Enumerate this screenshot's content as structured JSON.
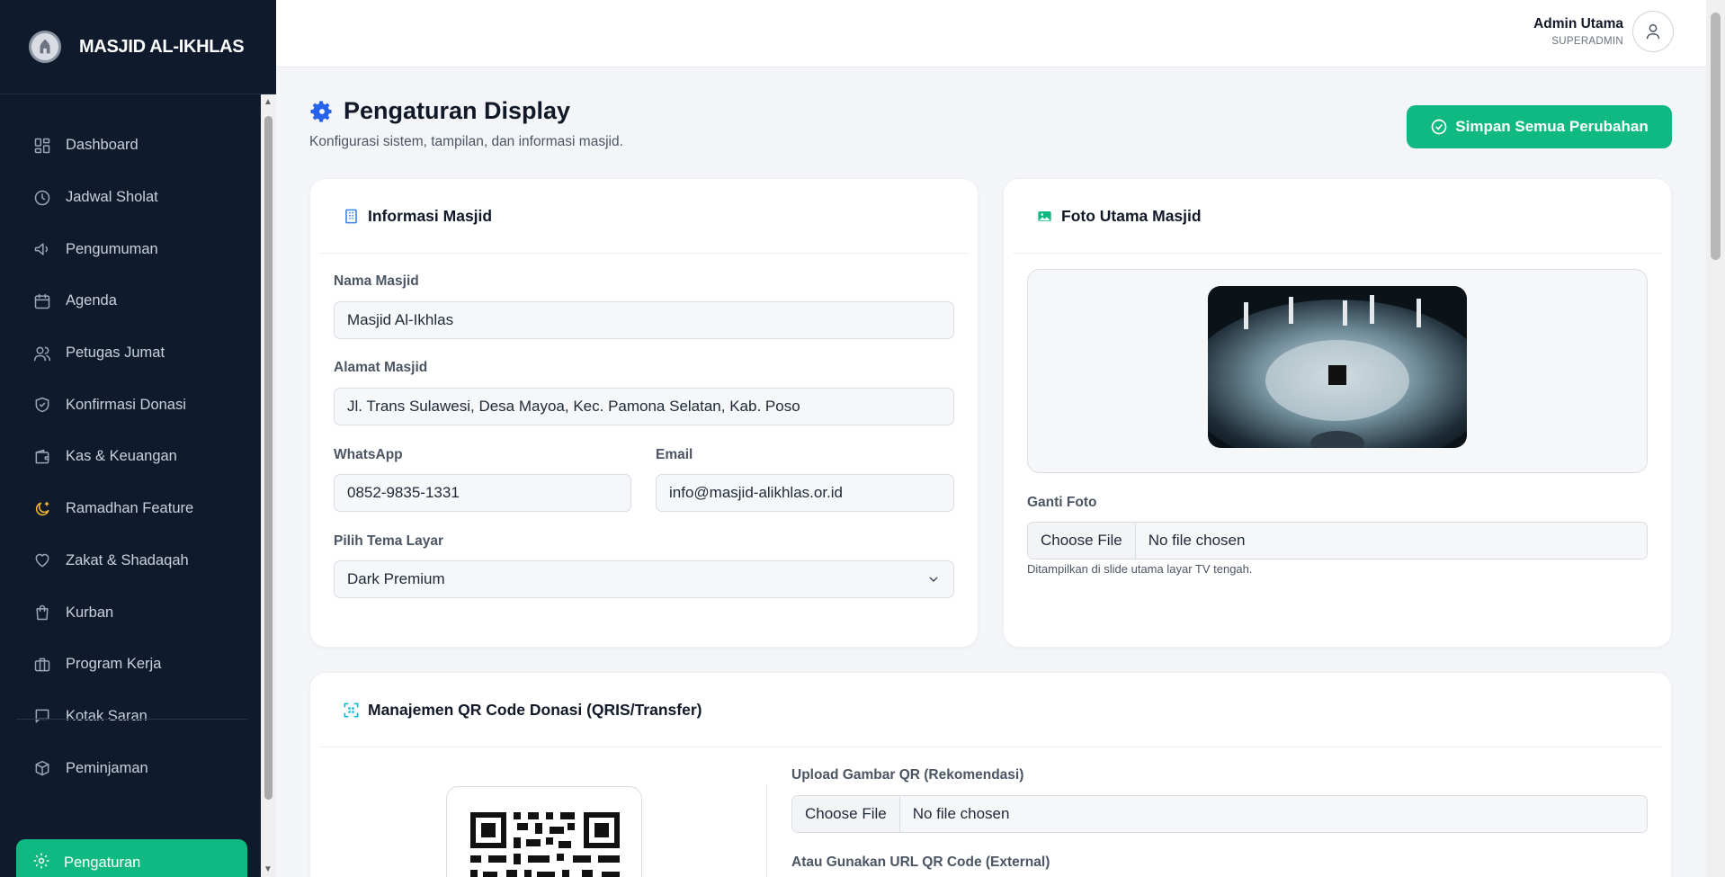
{
  "brand": {
    "title": "MASJID AL-IKHLAS"
  },
  "sidebar": {
    "items": [
      {
        "label": "Dashboard",
        "icon": "grid-icon"
      },
      {
        "label": "Jadwal Sholat",
        "icon": "clock-icon"
      },
      {
        "label": "Pengumuman",
        "icon": "megaphone-icon"
      },
      {
        "label": "Agenda",
        "icon": "calendar-icon"
      },
      {
        "label": "Petugas Jumat",
        "icon": "users-icon"
      },
      {
        "label": "Konfirmasi Donasi",
        "icon": "shield-check-icon"
      },
      {
        "label": "Kas & Keuangan",
        "icon": "wallet-icon"
      },
      {
        "label": "Ramadhan Feature",
        "icon": "moon-icon"
      },
      {
        "label": "Zakat & Shadaqah",
        "icon": "heart-icon"
      },
      {
        "label": "Kurban",
        "icon": "bag-icon"
      },
      {
        "label": "Program Kerja",
        "icon": "briefcase-icon"
      },
      {
        "label": "Kotak Saran",
        "icon": "message-icon"
      },
      {
        "label": "Peminjaman",
        "icon": "box-icon"
      }
    ],
    "active": {
      "label": "Pengaturan",
      "icon": "gear-icon"
    }
  },
  "header": {
    "user_name": "Admin Utama",
    "user_role": "SUPERADMIN"
  },
  "page": {
    "title": "Pengaturan Display",
    "subtitle": "Konfigurasi sistem, tampilan, dan informasi masjid.",
    "save_label": "Simpan Semua Perubahan"
  },
  "info_card": {
    "title": "Informasi Masjid",
    "nama_label": "Nama Masjid",
    "nama_value": "Masjid Al-Ikhlas",
    "alamat_label": "Alamat Masjid",
    "alamat_value": "Jl. Trans Sulawesi, Desa Mayoa, Kec. Pamona Selatan, Kab. Poso",
    "wa_label": "WhatsApp",
    "wa_value": "0852-9835-1331",
    "email_label": "Email",
    "email_value": "info@masjid-alikhlas.or.id",
    "tema_label": "Pilih Tema Layar",
    "tema_value": "Dark Premium"
  },
  "photo_card": {
    "title": "Foto Utama Masjid",
    "ganti_label": "Ganti Foto",
    "choose_label": "Choose File",
    "no_file": "No file chosen",
    "hint": "Ditampilkan di slide utama layar TV tengah."
  },
  "qr_card": {
    "title": "Manajemen QR Code Donasi (QRIS/Transfer)",
    "upload_label": "Upload Gambar QR (Rekomendasi)",
    "choose_label": "Choose File",
    "no_file": "No file chosen",
    "url_label": "Atau Gunakan URL QR Code (External)"
  },
  "colors": {
    "accent": "#10b981",
    "sidebar": "#0f1b2d",
    "info_icon": "#3b82f6",
    "photo_icon": "#10b981",
    "qr_icon": "#06b6d4"
  }
}
